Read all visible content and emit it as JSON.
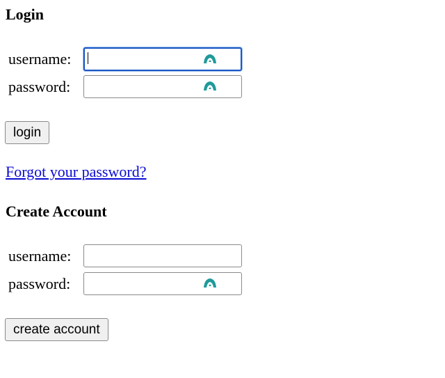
{
  "login": {
    "heading": "Login",
    "username_label": "username:",
    "password_label": "password:",
    "username_value": "",
    "password_value": "",
    "button_label": "login",
    "forgot_link": "Forgot your password?"
  },
  "create_account": {
    "heading": "Create Account",
    "username_label": "username:",
    "password_label": "password:",
    "username_value": "",
    "password_value": "",
    "button_label": "create account"
  },
  "icons": {
    "password_manager": "password-manager-icon"
  },
  "colors": {
    "focus_border": "#1a57c4",
    "link": "#0b0bd3",
    "icon_teal": "#1f9a9a"
  }
}
